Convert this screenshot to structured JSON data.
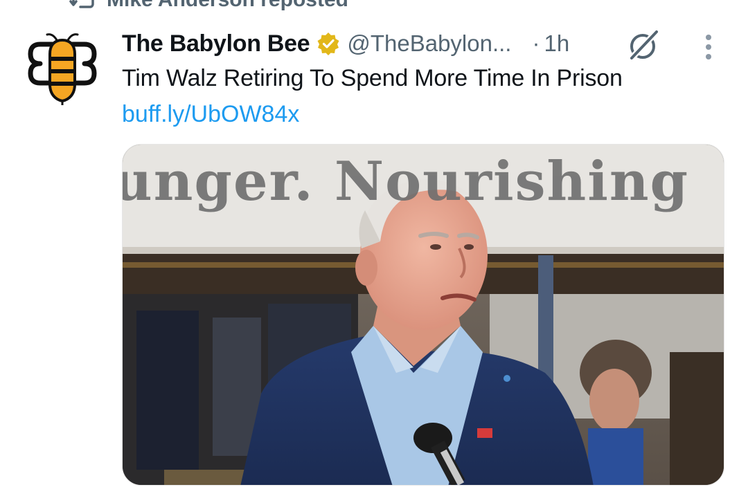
{
  "repost": {
    "text": "Mike Anderson reposted"
  },
  "tweet": {
    "author": {
      "display_name": "The Babylon Bee",
      "handle": "@TheBabylon...",
      "verified": true
    },
    "separator": "·",
    "timestamp": "1h",
    "text": "Tim Walz Retiring To Spend More Time In Prison",
    "link": "buff.ly/UbOW84x",
    "media": {
      "banner_text": "unger. Nourishing"
    }
  },
  "icons": {
    "repost": "repost-icon",
    "verified": "verified-badge-icon",
    "grok": "grok-icon",
    "more": "more-vertical-icon",
    "avatar": "babylon-bee-logo"
  },
  "colors": {
    "link": "#1d9bf0",
    "secondary_text": "#536471",
    "verified_gold": "#e2b719",
    "bee_orange": "#f5a623"
  }
}
